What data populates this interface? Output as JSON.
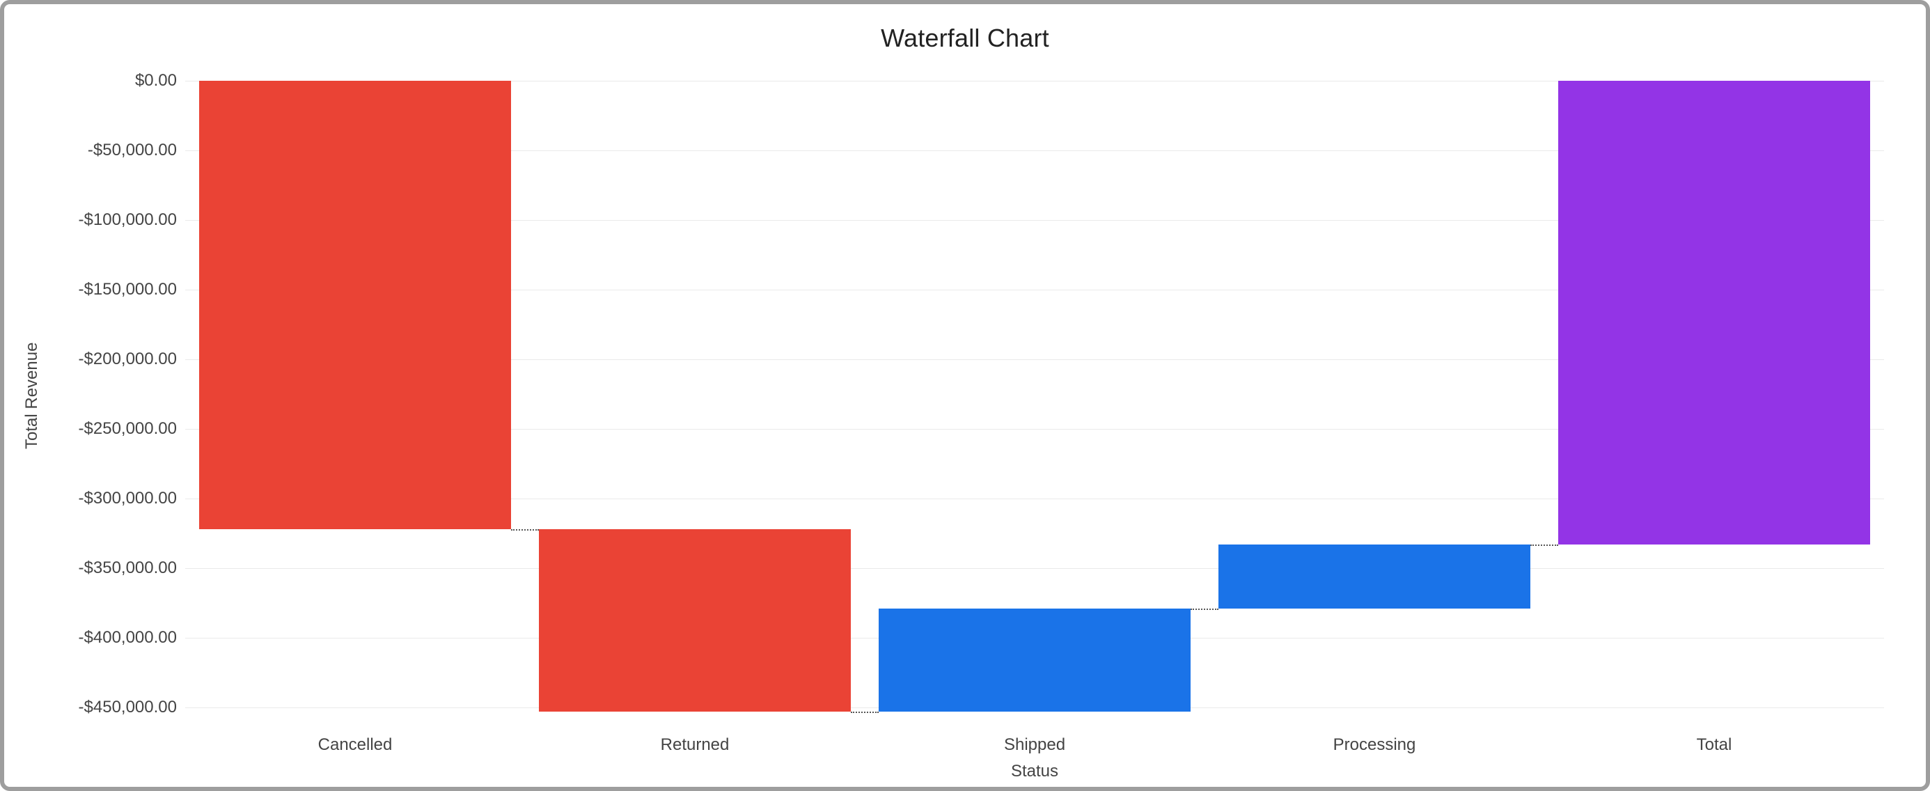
{
  "title": "Waterfall Chart",
  "ylabel": "Total Revenue",
  "xlabel": "Status",
  "chart_data": {
    "type": "bar",
    "subtype": "waterfall",
    "title": "Waterfall Chart",
    "xlabel": "Status",
    "ylabel": "Total Revenue",
    "ylim": [
      -460000,
      0
    ],
    "yticks": [
      0,
      -50000,
      -100000,
      -150000,
      -200000,
      -250000,
      -300000,
      -350000,
      -400000,
      -450000
    ],
    "ytick_labels": [
      "$0.00",
      "-$50,000.00",
      "-$100,000.00",
      "-$150,000.00",
      "-$200,000.00",
      "-$250,000.00",
      "-$300,000.00",
      "-$350,000.00",
      "-$400,000.00",
      "-$450,000.00"
    ],
    "categories": [
      "Cancelled",
      "Returned",
      "Shipped",
      "Processing",
      "Total"
    ],
    "series": [
      {
        "name": "Cancelled",
        "start": 0,
        "end": -322000,
        "delta": -322000,
        "kind": "decrease"
      },
      {
        "name": "Returned",
        "start": -322000,
        "end": -453000,
        "delta": -131000,
        "kind": "decrease"
      },
      {
        "name": "Shipped",
        "start": -453000,
        "end": -379000,
        "delta": 74000,
        "kind": "increase"
      },
      {
        "name": "Processing",
        "start": -379000,
        "end": -333000,
        "delta": 46000,
        "kind": "increase"
      },
      {
        "name": "Total",
        "start": 0,
        "end": -333000,
        "delta": -333000,
        "kind": "total"
      }
    ],
    "colors": {
      "decrease": "#ea4335",
      "increase": "#1a73e8",
      "total": "#9334e6"
    }
  }
}
